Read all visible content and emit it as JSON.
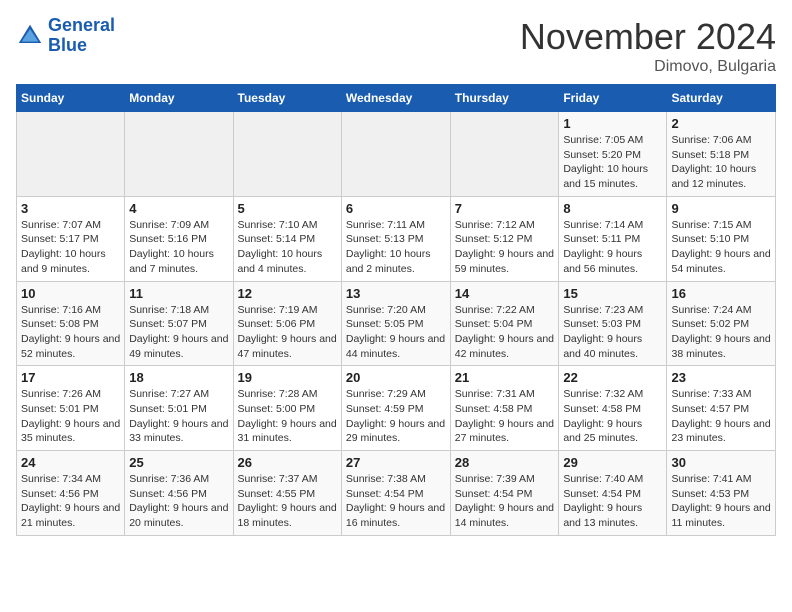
{
  "header": {
    "logo_line1": "General",
    "logo_line2": "Blue",
    "month": "November 2024",
    "location": "Dimovo, Bulgaria"
  },
  "weekdays": [
    "Sunday",
    "Monday",
    "Tuesday",
    "Wednesday",
    "Thursday",
    "Friday",
    "Saturday"
  ],
  "weeks": [
    [
      {
        "day": "",
        "info": ""
      },
      {
        "day": "",
        "info": ""
      },
      {
        "day": "",
        "info": ""
      },
      {
        "day": "",
        "info": ""
      },
      {
        "day": "",
        "info": ""
      },
      {
        "day": "1",
        "info": "Sunrise: 7:05 AM\nSunset: 5:20 PM\nDaylight: 10 hours and 15 minutes."
      },
      {
        "day": "2",
        "info": "Sunrise: 7:06 AM\nSunset: 5:18 PM\nDaylight: 10 hours and 12 minutes."
      }
    ],
    [
      {
        "day": "3",
        "info": "Sunrise: 7:07 AM\nSunset: 5:17 PM\nDaylight: 10 hours and 9 minutes."
      },
      {
        "day": "4",
        "info": "Sunrise: 7:09 AM\nSunset: 5:16 PM\nDaylight: 10 hours and 7 minutes."
      },
      {
        "day": "5",
        "info": "Sunrise: 7:10 AM\nSunset: 5:14 PM\nDaylight: 10 hours and 4 minutes."
      },
      {
        "day": "6",
        "info": "Sunrise: 7:11 AM\nSunset: 5:13 PM\nDaylight: 10 hours and 2 minutes."
      },
      {
        "day": "7",
        "info": "Sunrise: 7:12 AM\nSunset: 5:12 PM\nDaylight: 9 hours and 59 minutes."
      },
      {
        "day": "8",
        "info": "Sunrise: 7:14 AM\nSunset: 5:11 PM\nDaylight: 9 hours and 56 minutes."
      },
      {
        "day": "9",
        "info": "Sunrise: 7:15 AM\nSunset: 5:10 PM\nDaylight: 9 hours and 54 minutes."
      }
    ],
    [
      {
        "day": "10",
        "info": "Sunrise: 7:16 AM\nSunset: 5:08 PM\nDaylight: 9 hours and 52 minutes."
      },
      {
        "day": "11",
        "info": "Sunrise: 7:18 AM\nSunset: 5:07 PM\nDaylight: 9 hours and 49 minutes."
      },
      {
        "day": "12",
        "info": "Sunrise: 7:19 AM\nSunset: 5:06 PM\nDaylight: 9 hours and 47 minutes."
      },
      {
        "day": "13",
        "info": "Sunrise: 7:20 AM\nSunset: 5:05 PM\nDaylight: 9 hours and 44 minutes."
      },
      {
        "day": "14",
        "info": "Sunrise: 7:22 AM\nSunset: 5:04 PM\nDaylight: 9 hours and 42 minutes."
      },
      {
        "day": "15",
        "info": "Sunrise: 7:23 AM\nSunset: 5:03 PM\nDaylight: 9 hours and 40 minutes."
      },
      {
        "day": "16",
        "info": "Sunrise: 7:24 AM\nSunset: 5:02 PM\nDaylight: 9 hours and 38 minutes."
      }
    ],
    [
      {
        "day": "17",
        "info": "Sunrise: 7:26 AM\nSunset: 5:01 PM\nDaylight: 9 hours and 35 minutes."
      },
      {
        "day": "18",
        "info": "Sunrise: 7:27 AM\nSunset: 5:01 PM\nDaylight: 9 hours and 33 minutes."
      },
      {
        "day": "19",
        "info": "Sunrise: 7:28 AM\nSunset: 5:00 PM\nDaylight: 9 hours and 31 minutes."
      },
      {
        "day": "20",
        "info": "Sunrise: 7:29 AM\nSunset: 4:59 PM\nDaylight: 9 hours and 29 minutes."
      },
      {
        "day": "21",
        "info": "Sunrise: 7:31 AM\nSunset: 4:58 PM\nDaylight: 9 hours and 27 minutes."
      },
      {
        "day": "22",
        "info": "Sunrise: 7:32 AM\nSunset: 4:58 PM\nDaylight: 9 hours and 25 minutes."
      },
      {
        "day": "23",
        "info": "Sunrise: 7:33 AM\nSunset: 4:57 PM\nDaylight: 9 hours and 23 minutes."
      }
    ],
    [
      {
        "day": "24",
        "info": "Sunrise: 7:34 AM\nSunset: 4:56 PM\nDaylight: 9 hours and 21 minutes."
      },
      {
        "day": "25",
        "info": "Sunrise: 7:36 AM\nSunset: 4:56 PM\nDaylight: 9 hours and 20 minutes."
      },
      {
        "day": "26",
        "info": "Sunrise: 7:37 AM\nSunset: 4:55 PM\nDaylight: 9 hours and 18 minutes."
      },
      {
        "day": "27",
        "info": "Sunrise: 7:38 AM\nSunset: 4:54 PM\nDaylight: 9 hours and 16 minutes."
      },
      {
        "day": "28",
        "info": "Sunrise: 7:39 AM\nSunset: 4:54 PM\nDaylight: 9 hours and 14 minutes."
      },
      {
        "day": "29",
        "info": "Sunrise: 7:40 AM\nSunset: 4:54 PM\nDaylight: 9 hours and 13 minutes."
      },
      {
        "day": "30",
        "info": "Sunrise: 7:41 AM\nSunset: 4:53 PM\nDaylight: 9 hours and 11 minutes."
      }
    ]
  ]
}
